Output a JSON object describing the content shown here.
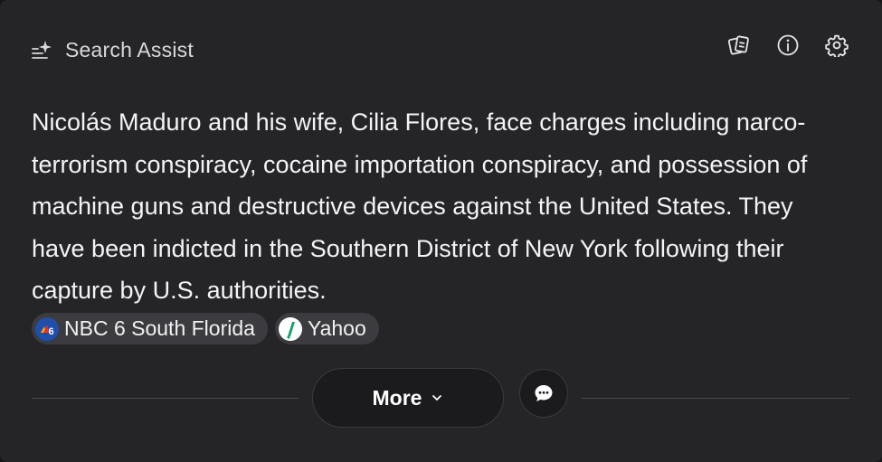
{
  "header": {
    "title": "Search Assist",
    "icon": "sparkle-list-icon",
    "tools": [
      {
        "name": "sources-icon"
      },
      {
        "name": "info-icon"
      },
      {
        "name": "gear-icon"
      }
    ]
  },
  "answer": {
    "text": "Nicolás Maduro and his wife, Cilia Flores, face charges including narco-terrorism conspiracy, cocaine importation conspiracy, and possession of machine guns and destructive devices against the United States. They have been indicted in the Southern District of New York following their capture by U.S. authorities."
  },
  "sources": [
    {
      "label": "NBC 6 South Florida",
      "favicon": "nbc6-logo",
      "color": "#1f4fa8"
    },
    {
      "label": "Yahoo",
      "favicon": "yahoo-logo",
      "color": "#17a16a"
    }
  ],
  "actions": {
    "more_label": "More",
    "chat_icon": "chat-bubble-icon"
  },
  "colors": {
    "card_bg": "#252528",
    "chip_bg": "#3c3c40",
    "button_bg": "#1b1b1d",
    "text": "#f4f4f5"
  }
}
